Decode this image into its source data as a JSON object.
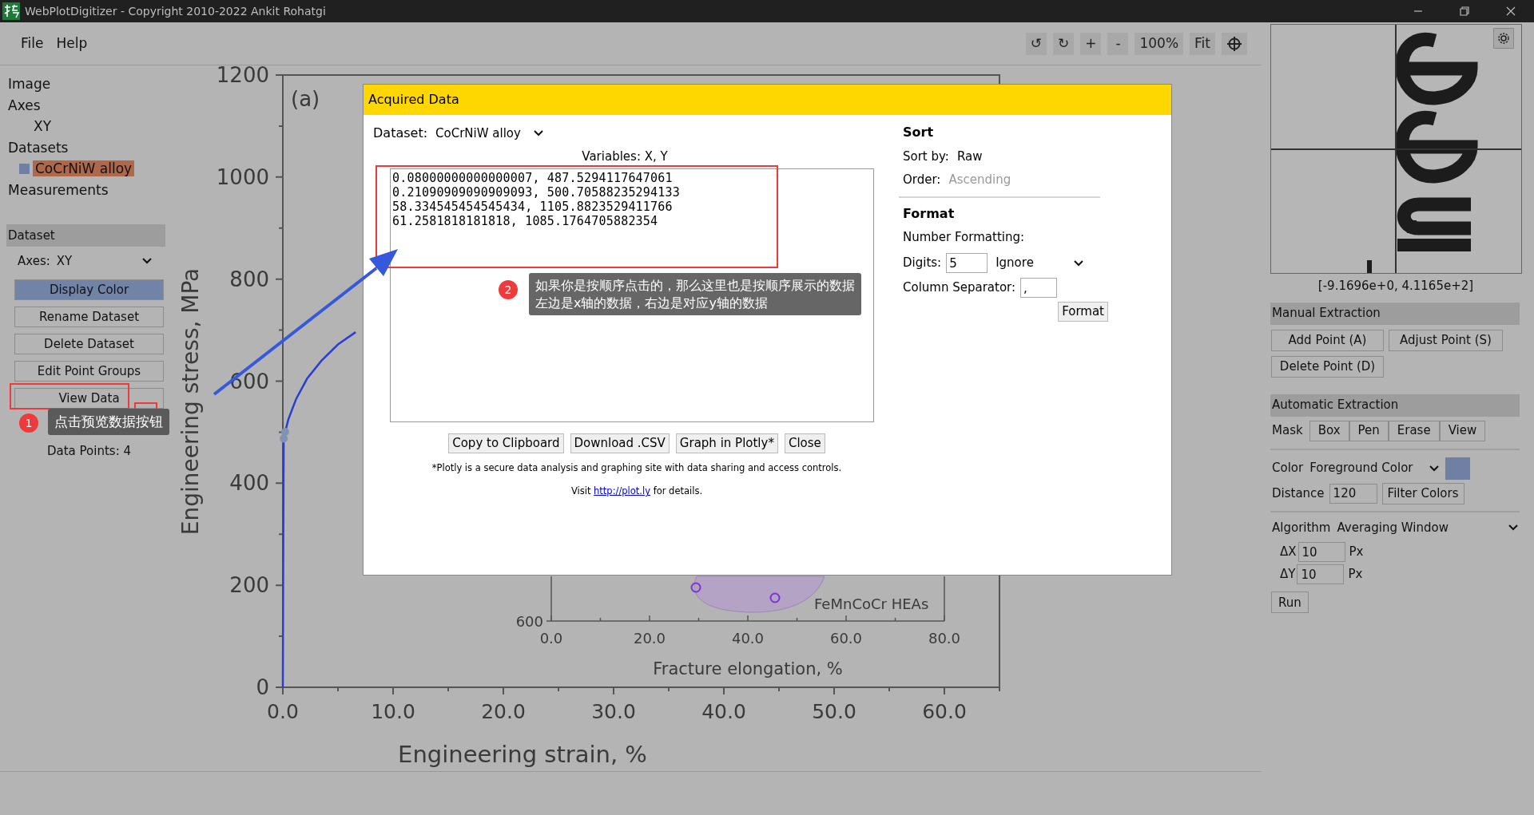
{
  "window": {
    "title": "WebPlotDigitizer - Copyright 2010-2022 Ankit Rohatgi"
  },
  "menu": [
    {
      "label": "File"
    },
    {
      "label": "Help"
    }
  ],
  "toolbar": [
    {
      "kind": "text",
      "label": "↺"
    },
    {
      "kind": "text",
      "label": "↻"
    },
    {
      "kind": "text",
      "label": "+"
    },
    {
      "kind": "text",
      "label": "-"
    },
    {
      "kind": "text",
      "label": "100%"
    },
    {
      "kind": "text",
      "label": "Fit"
    },
    {
      "kind": "crosshair"
    }
  ],
  "sidebar": {
    "tree": [
      {
        "label": "Image",
        "selected": false
      },
      {
        "label": "Axes",
        "selected": false,
        "children": [
          {
            "label": "XY",
            "selected": false
          }
        ]
      },
      {
        "label": "Datasets",
        "selected": false,
        "children": [
          {
            "label": "CoCrNiW alloy",
            "selected": true,
            "color": "#6f80a4"
          }
        ]
      },
      {
        "label": "Measurements",
        "selected": false
      }
    ],
    "dataset_panel": {
      "title": "Dataset",
      "axes_label": "Axes:",
      "axes_value": "XY",
      "buttons": [
        {
          "label": "Display Color",
          "kind": "color"
        },
        {
          "label": "Rename Dataset",
          "kind": "plain"
        },
        {
          "label": "Delete Dataset",
          "kind": "plain"
        },
        {
          "label": "Edit Point Groups",
          "kind": "plain"
        },
        {
          "label": "View Data",
          "kind": "plain"
        }
      ],
      "data_points": "Data Points: 4"
    }
  },
  "plot": {
    "chart_data": {
      "type": "line",
      "xlabel": "Engineering strain, %",
      "ylabel": "Engineering stress, MPa",
      "x": [
        0,
        0.02,
        0.05,
        0.08,
        0.21,
        0.5,
        1.2,
        2.2,
        3.5,
        5,
        6.6
      ],
      "series": [
        {
          "color": "#2a3fd0",
          "values": [
            0,
            150,
            330,
            487,
            500,
            525,
            565,
            605,
            640,
            672,
            696
          ]
        }
      ],
      "xlim": [
        0,
        65
      ],
      "ylim": [
        0,
        1200
      ],
      "xticks": [
        {
          "value": 0,
          "label": "0.0"
        },
        {
          "value": 10,
          "label": "10.0"
        },
        {
          "value": 20,
          "label": "20.0"
        },
        {
          "value": 30,
          "label": "30.0"
        },
        {
          "value": 40,
          "label": "40.0"
        },
        {
          "value": 50,
          "label": "50.0"
        },
        {
          "value": 60,
          "label": "60.0"
        }
      ],
      "yticks": [
        0,
        200,
        400,
        600,
        800,
        1000,
        1200
      ],
      "annotations": [
        "(a)"
      ]
    },
    "inset": {
      "kind": "scatter",
      "xlabel": "Fracture elongation, %",
      "x_tick_labels": [
        "0.0",
        "20.0",
        "40.0",
        "60.0",
        "80.0"
      ],
      "y_tick_label": "600",
      "region_label": "FeMnCoCr HEAs"
    }
  },
  "right_panel": {
    "coordinates": "[-9.1696e+0, 4.1165e+2]",
    "manual": {
      "title": "Manual Extraction",
      "buttons": [
        "Add Point (A)",
        "Adjust Point (S)",
        "Delete Point (D)"
      ]
    },
    "automatic": {
      "title": "Automatic Extraction",
      "mask_label": "Mask",
      "mask_tools": [
        "Box",
        "Pen",
        "Erase",
        "View"
      ],
      "color_label": "Color",
      "color_mode": "Foreground Color",
      "color": "#6f80a4",
      "distance_label": "Distance",
      "distance": "120",
      "filter_button": "Filter Colors",
      "algorithm_label": "Algorithm",
      "algorithm": "Averaging Window",
      "params": [
        {
          "label": "ΔX",
          "value": "10",
          "unit": "Px"
        },
        {
          "label": "ΔY",
          "value": "10",
          "unit": "Px"
        }
      ],
      "run_button": "Run"
    }
  },
  "dialog": {
    "title": "Acquired Data",
    "dataset_label": "Dataset:",
    "dataset_value": "CoCrNiW alloy",
    "variables": "Variables: X, Y",
    "rows": [
      "0.08000000000000007, 487.5294117647061",
      "0.21090909090909093, 500.70588235294133",
      "58.334545454545434, 1105.8823529411766",
      "61.2581818181818, 1085.1764705882354"
    ],
    "buttons": [
      "Copy to Clipboard",
      "Download .CSV",
      "Graph in Plotly*",
      "Close"
    ],
    "footnote": "*Plotly is a secure data analysis and graphing site with data sharing and access controls.",
    "visit_before": "Visit",
    "link": "http://plot.ly",
    "visit_after": "for details.",
    "sort": {
      "title": "Sort",
      "sort_by_label": "Sort by:",
      "sort_by": "Raw",
      "order_label": "Order:",
      "order": "Ascending",
      "order_disabled": true
    },
    "format": {
      "title": "Format",
      "number_label": "Number Formatting:",
      "digits_label": "Digits:",
      "digits": "5",
      "digits_mode": "Ignore",
      "separator_label": "Column Separator:",
      "separator": ",",
      "button": "Format"
    }
  },
  "annotations": [
    {
      "number": "1",
      "lines": [
        "点击预览数据按钮"
      ]
    },
    {
      "number": "2",
      "lines": [
        "如果你是按顺序点击的，那么这里也是按顺序展示的数据",
        "左边是x轴的数据，右边是对应y轴的数据"
      ]
    }
  ]
}
